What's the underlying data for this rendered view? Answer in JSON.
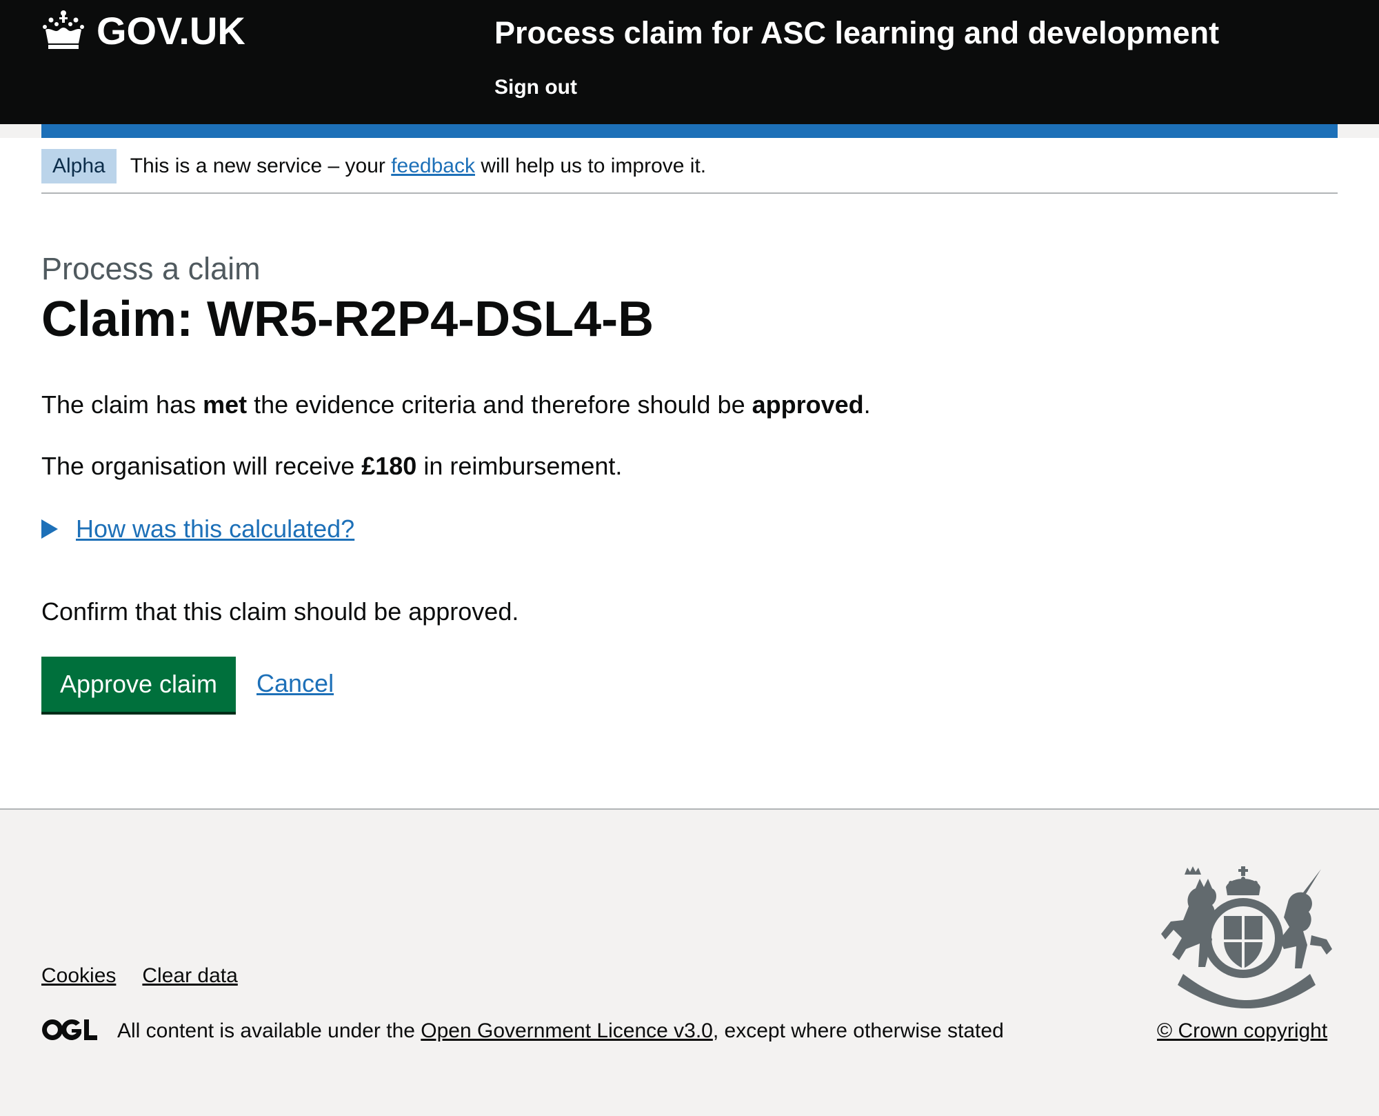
{
  "header": {
    "logo_text": "GOV.UK",
    "service_name": "Process claim for ASC learning and development",
    "signout_label": "Sign out"
  },
  "phase_banner": {
    "tag": "Alpha",
    "text_before": "This is a new service – your ",
    "link_text": "feedback",
    "text_after": " will help us to improve it."
  },
  "main": {
    "caption": "Process a claim",
    "title": "Claim: WR5-R2P4-DSL4-B",
    "para1_a": "The claim has ",
    "para1_b": "met",
    "para1_c": " the evidence criteria and therefore should be ",
    "para1_d": "approved",
    "para1_e": ".",
    "para2_a": "The organisation will receive ",
    "para2_amount": "£180",
    "para2_b": " in reimbursement.",
    "details_summary": "How was this calculated?",
    "confirm_text": "Confirm that this claim should be approved.",
    "approve_label": "Approve claim",
    "cancel_label": "Cancel"
  },
  "footer": {
    "links": [
      "Cookies",
      "Clear data"
    ],
    "licence_before": "All content is available under the ",
    "licence_link": "Open Government Licence v3.0",
    "licence_after": ", except where otherwise stated",
    "copyright": "© Crown copyright"
  },
  "colors": {
    "header_bg": "#0b0c0c",
    "brand_blue": "#1d70b8",
    "button_green": "#00703c",
    "phase_tag_bg": "#bbd4ea",
    "footer_bg": "#f3f2f1"
  },
  "icons": [
    "crown-icon",
    "ogl-icon",
    "royal-crest-icon",
    "details-triangle-icon"
  ]
}
